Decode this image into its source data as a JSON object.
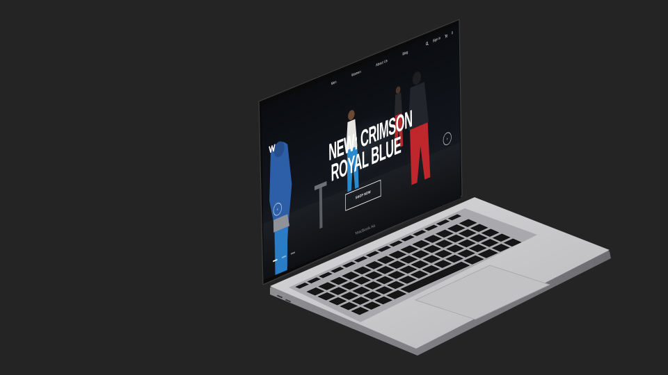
{
  "device": {
    "model_label": "MacBook Air"
  },
  "site": {
    "logo": "W-logo-icon",
    "nav": {
      "links": [
        "Men",
        "Women",
        "About Us",
        "Blog"
      ],
      "sign_in": "Sign in",
      "cart_count": "0"
    },
    "hero": {
      "title_line_1": "NEW: CRIMSON",
      "title_line_2": "ROYAL BLUE",
      "cta_label": "SHOP NOW",
      "prev_icon": "arrow-left-icon",
      "next_icon": "arrow-right-icon",
      "slides_total": 3,
      "slide_active": 1
    }
  },
  "colors": {
    "background": "#242424",
    "laptop_silver": "#c9c9cb",
    "screen_bg": "#0b0d10",
    "text_primary": "#ffffff"
  }
}
